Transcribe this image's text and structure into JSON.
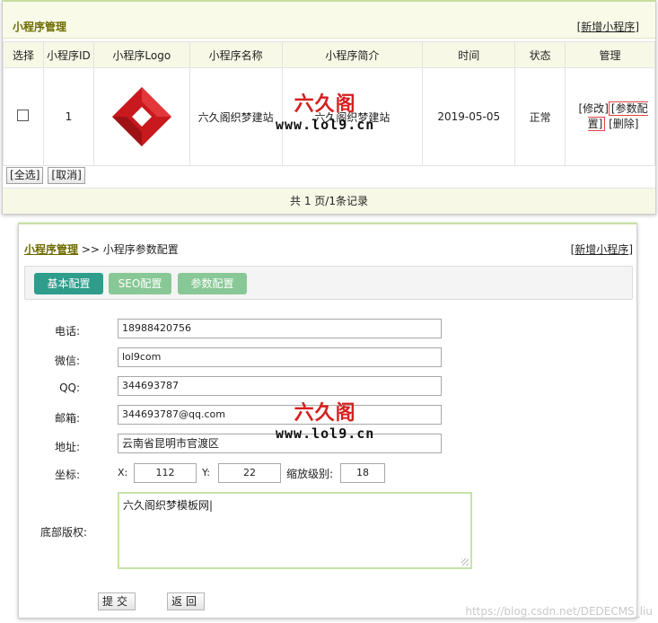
{
  "list": {
    "title": "小程序管理",
    "add_link": "新增小程序",
    "columns": [
      "选择",
      "小程序ID",
      "小程序Logo",
      "小程序名称",
      "小程序简介",
      "时间",
      "状态",
      "管理"
    ],
    "row": {
      "id": "1",
      "name": "六久阁织梦建站",
      "intro": "六久阁织梦建站",
      "time": "2019-05-05",
      "status": "正常",
      "status_color": "#3a9a3a",
      "actions": {
        "edit": "修改",
        "config": "参数配置",
        "delete": "删除"
      }
    },
    "select_all": "全选",
    "cancel": "取消",
    "pagination": "共 1 页/1条记录"
  },
  "config": {
    "breadcrumb_root": "小程序管理",
    "breadcrumb_sep": ">>",
    "breadcrumb_current": "小程序参数配置",
    "add_link": "新增小程序",
    "tabs": [
      "基本配置",
      "SEO配置",
      "参数配置"
    ],
    "fields": {
      "phone_label": "电话:",
      "phone": "18988420756",
      "wechat_label": "微信:",
      "wechat": "lol9com",
      "qq_label": "QQ:",
      "qq": "344693787",
      "email_label": "邮箱:",
      "email": "344693787@qq.com",
      "address_label": "地址:",
      "address": "云南省昆明市官渡区",
      "coord_label": "坐标:",
      "x_label": "X:",
      "x": "112",
      "y_label": "Y:",
      "y": "22",
      "zoom_label": "缩放级别:",
      "zoom": "18",
      "copyright_label": "底部版权:",
      "copyright": "六久阁织梦模板网"
    },
    "submit": "提交",
    "back": "返回"
  },
  "watermark": {
    "logo_text": "六久阁",
    "url": "www.lol9.cn",
    "footer": "https://blog.csdn.net/DEDECMS_liu"
  },
  "colors": {
    "tab_active": "#2e9d8c",
    "tab_inactive": "#88c896",
    "title_olive": "#6d6a00",
    "logo_red": "#d6201f"
  }
}
